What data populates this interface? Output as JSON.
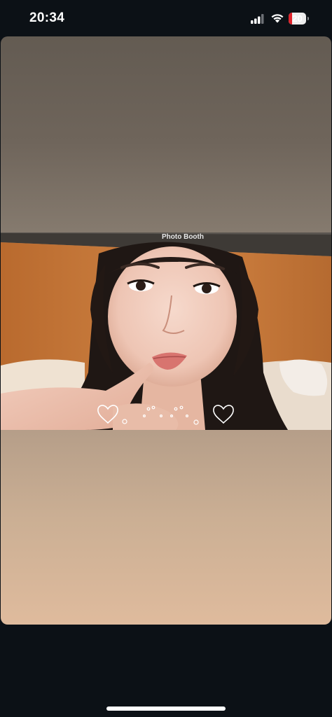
{
  "status_bar": {
    "time": "20:34",
    "signal_icon": "cellular-signal-icon",
    "wifi_icon": "wifi-icon",
    "battery_level": "20",
    "battery_level_fraction": 0.2,
    "battery_color": "#e0232b"
  },
  "story": {
    "window_title": "Photo Booth",
    "photo_icon": "selfie-photo",
    "decorations": [
      "heart-icon",
      "heart-icon"
    ]
  },
  "colors": {
    "background": "#0c1116",
    "card_top": "#635b52",
    "card_bottom": "#dfbb9d"
  }
}
